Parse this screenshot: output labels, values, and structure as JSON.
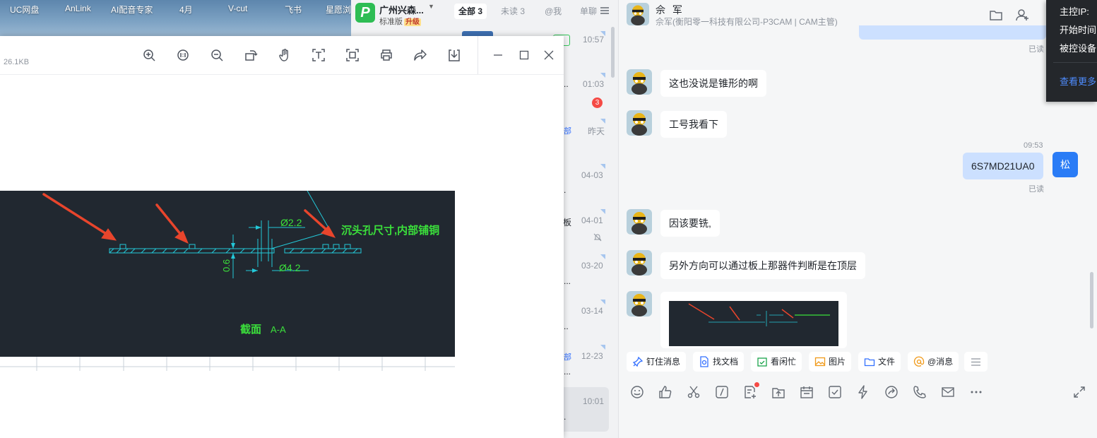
{
  "desktop": {
    "icons": [
      "UC网盘",
      "AnLink",
      "AI配音专家",
      "4月",
      "V-cut",
      "飞书",
      "星愿浏"
    ]
  },
  "org": {
    "name": "广州兴森...",
    "plan": "标准版",
    "upgrade": "升级"
  },
  "filters": [
    {
      "label": "全部 3"
    },
    {
      "label": "未读 3"
    },
    {
      "label": "@我"
    },
    {
      "label": "单聊"
    }
  ],
  "conversations": [
    {
      "time": "10:57",
      "tag": "",
      "fragment": ""
    },
    {
      "time": "01:03",
      "tag": "",
      "fragment": "..",
      "unread": "3"
    },
    {
      "time": "昨天",
      "tag": "部",
      "fragment": ""
    },
    {
      "time": "04-03",
      "tag": "",
      "fragment": "."
    },
    {
      "time": "04-01",
      "tag": "",
      "fragment": "板"
    },
    {
      "time": "03-20",
      "tag": "",
      "fragment": "..."
    },
    {
      "time": "03-14",
      "tag": "",
      "fragment": ".."
    },
    {
      "time": "12-23",
      "tag": "部",
      "fragment": "..."
    },
    {
      "time": "10:01",
      "tag": "",
      "fragment": "."
    }
  ],
  "viewer": {
    "file_size": "26.1KB",
    "tools": [
      "zoom-in-icon",
      "fit-icon",
      "zoom-out-icon",
      "rotate-icon",
      "hand-icon",
      "text-recognize-icon",
      "scan-icon",
      "print-icon",
      "share-icon",
      "download-icon"
    ]
  },
  "cad": {
    "d1": "Ø2.2",
    "d2": "Ø4.2",
    "thick": "0.6",
    "note": "沉头孔尺寸,内部铺铜",
    "section": "截面",
    "section_id": "A-A",
    "colors": {
      "bg": "#212830",
      "line": "#23c8d8",
      "text": "#3be03b",
      "arrow": "#e8452c"
    }
  },
  "chat": {
    "header": {
      "name": "佘 军",
      "subtitle": "佘军(衡阳零一科技有限公司-P3CAM | CAM主管)"
    },
    "read_label": "已读",
    "messages": [
      {
        "text": "这也没说是锥形的啊"
      },
      {
        "text": "工号我看下"
      },
      {
        "text": "6S7MD21UA0",
        "time": "09:53",
        "mine": true
      },
      {
        "text": "因该要铣,"
      },
      {
        "text": "另外方向可以通过板上那器件判断是在顶层"
      }
    ],
    "self_avatar": "松",
    "quick_actions": [
      "钉住消息",
      "找文档",
      "看闲忙",
      "图片",
      "文件",
      "@消息"
    ],
    "accent": "#3370ff"
  },
  "info_popup": {
    "lines": [
      "主控IP:",
      "开始时间",
      "被控设备"
    ],
    "link": "查看更多"
  }
}
